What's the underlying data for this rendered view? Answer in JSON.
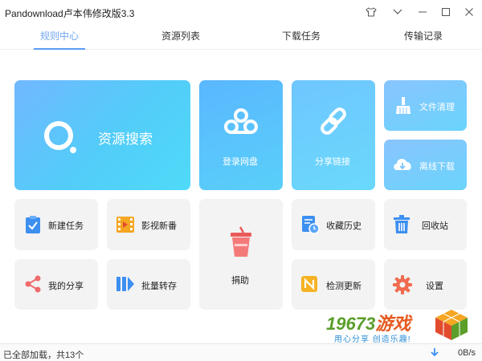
{
  "window": {
    "title": "Pandownload卢本伟修改版3.3",
    "controls": [
      "shirt-icon",
      "chevron-down-icon",
      "minimize-icon",
      "maximize-icon",
      "close-icon"
    ]
  },
  "tabs": [
    {
      "label": "规则中心",
      "active": true
    },
    {
      "label": "资源列表",
      "active": false
    },
    {
      "label": "下载任务",
      "active": false
    },
    {
      "label": "传输记录",
      "active": false
    }
  ],
  "tiles": {
    "search": "资源搜索",
    "login": "登录网盘",
    "share": "分享链接",
    "clean": "文件清理",
    "offline": "离线下载",
    "new_task": "新建任务",
    "movies": "影视新番",
    "donate": "捐助",
    "history": "收藏历史",
    "recycle": "回收站",
    "my_share": "我的分享",
    "batch": "批量转存",
    "update": "检测更新",
    "settings": "设置"
  },
  "status": {
    "loaded": "已全部加载，共13个",
    "speed": "0B/s"
  },
  "watermark": {
    "brand_num": "19673",
    "brand_word": "游戏",
    "slogan": "用心分享  创造乐趣!"
  },
  "colors": {
    "accent": "#5a9cf5",
    "tile_grey": "#f3f3f3"
  }
}
